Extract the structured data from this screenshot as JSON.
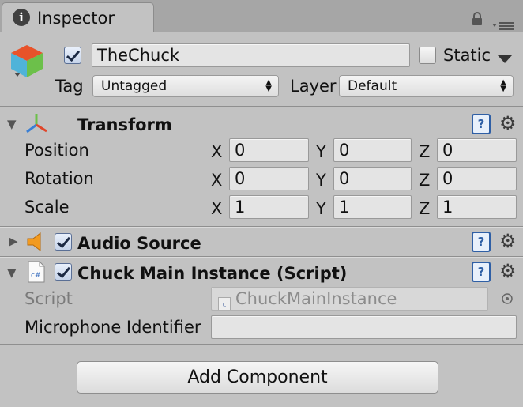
{
  "tab": {
    "title": "Inspector"
  },
  "header": {
    "active": true,
    "object_name": "TheChuck",
    "static_label": "Static",
    "static_checked": false,
    "tag_label": "Tag",
    "tag_value": "Untagged",
    "layer_label": "Layer",
    "layer_value": "Default"
  },
  "transform": {
    "title": "Transform",
    "rows": [
      {
        "label": "Position",
        "x": "0",
        "y": "0",
        "z": "0"
      },
      {
        "label": "Rotation",
        "x": "0",
        "y": "0",
        "z": "0"
      },
      {
        "label": "Scale",
        "x": "1",
        "y": "1",
        "z": "1"
      }
    ],
    "axis_x": "X",
    "axis_y": "Y",
    "axis_z": "Z"
  },
  "audio_source": {
    "title": "Audio Source",
    "enabled": true,
    "expanded": false
  },
  "chuck_script": {
    "title": "Chuck Main Instance (Script)",
    "enabled": true,
    "script_label": "Script",
    "script_value": "ChuckMainInstance",
    "mic_label": "Microphone Identifier",
    "mic_value": ""
  },
  "add_component_label": "Add Component",
  "icons": {
    "tab": "info-icon",
    "lock": "lock-icon",
    "menu": "menu-icon",
    "object": "gameobject-cube-icon",
    "transform": "transform-axes-icon",
    "audio": "speaker-icon",
    "script": "csharp-script-icon",
    "help": "help-icon",
    "settings": "gear-icon"
  },
  "colors": {
    "panel": "#c2c2c2",
    "tabbar": "#a6a6a6",
    "help_blue": "#2f5fa5",
    "checkbox_blue": "#5a6f95"
  }
}
